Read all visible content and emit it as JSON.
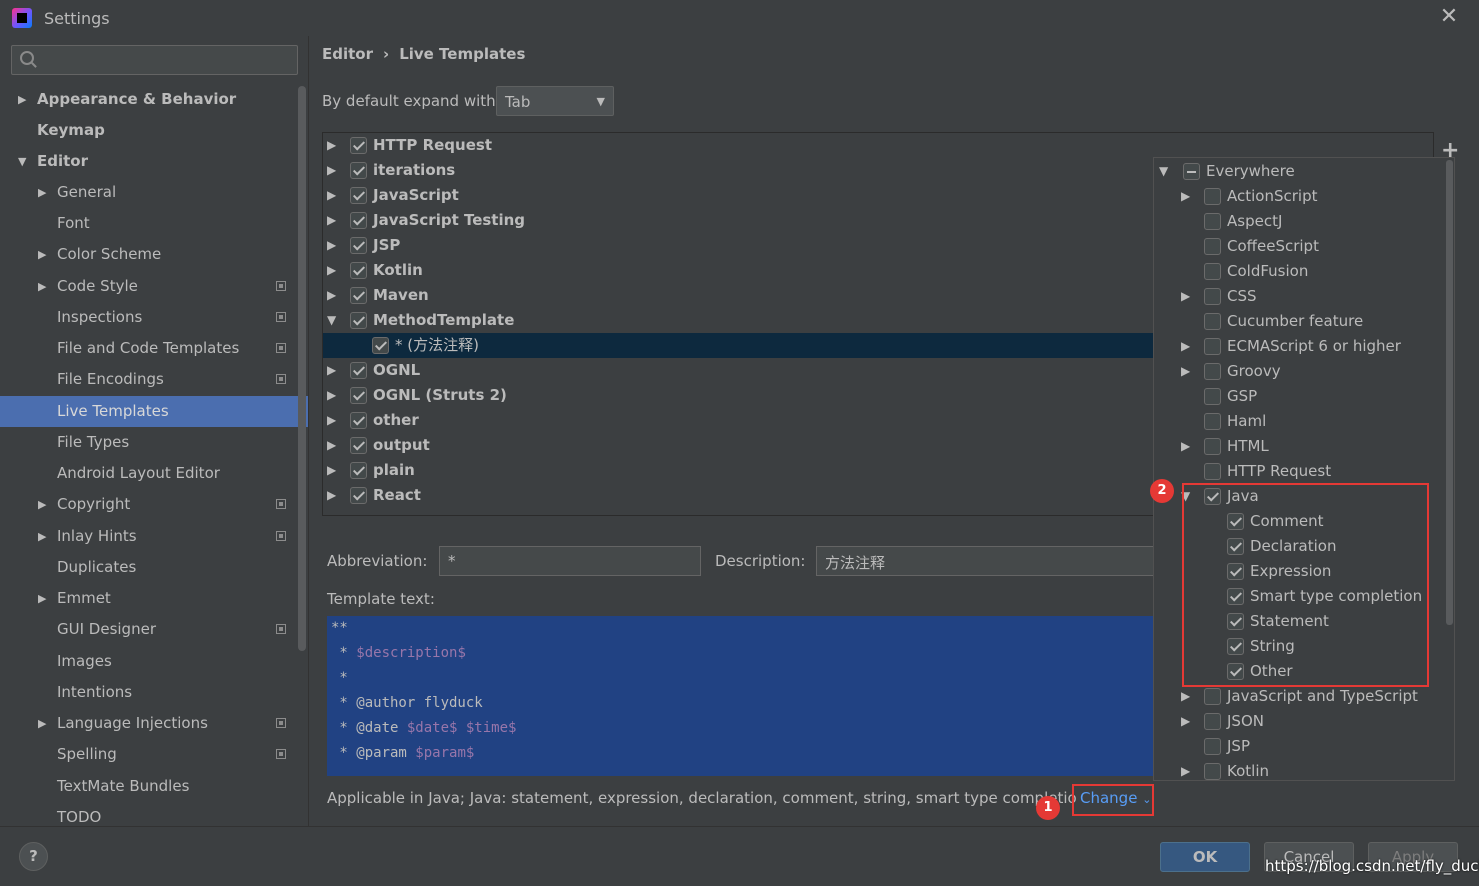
{
  "window": {
    "title": "Settings"
  },
  "sidebar": {
    "search_placeholder": "",
    "items": [
      {
        "label": "Appearance & Behavior"
      },
      {
        "label": "Keymap"
      },
      {
        "label": "Editor"
      },
      {
        "label": "General"
      },
      {
        "label": "Font"
      },
      {
        "label": "Color Scheme"
      },
      {
        "label": "Code Style"
      },
      {
        "label": "Inspections"
      },
      {
        "label": "File and Code Templates"
      },
      {
        "label": "File Encodings"
      },
      {
        "label": "Live Templates"
      },
      {
        "label": "File Types"
      },
      {
        "label": "Android Layout Editor"
      },
      {
        "label": "Copyright"
      },
      {
        "label": "Inlay Hints"
      },
      {
        "label": "Duplicates"
      },
      {
        "label": "Emmet"
      },
      {
        "label": "GUI Designer"
      },
      {
        "label": "Images"
      },
      {
        "label": "Intentions"
      },
      {
        "label": "Language Injections"
      },
      {
        "label": "Spelling"
      },
      {
        "label": "TextMate Bundles"
      },
      {
        "label": "TODO"
      }
    ]
  },
  "breadcrumb": {
    "parent": "Editor",
    "separator": "›",
    "current": "Live Templates"
  },
  "expand": {
    "label": "By default expand with",
    "value": "Tab"
  },
  "template_groups": [
    {
      "label": "HTTP Request",
      "checked": true
    },
    {
      "label": "iterations",
      "checked": true
    },
    {
      "label": "JavaScript",
      "checked": true
    },
    {
      "label": "JavaScript Testing",
      "checked": true
    },
    {
      "label": "JSP",
      "checked": true
    },
    {
      "label": "Kotlin",
      "checked": true
    },
    {
      "label": "Maven",
      "checked": true
    },
    {
      "label": "MethodTemplate",
      "checked": true,
      "expanded": true
    },
    {
      "label": "* (方法注释)",
      "checked": true,
      "child": true,
      "selected": true
    },
    {
      "label": "OGNL",
      "checked": true
    },
    {
      "label": "OGNL (Struts 2)",
      "checked": true
    },
    {
      "label": "other",
      "checked": true
    },
    {
      "label": "output",
      "checked": true
    },
    {
      "label": "plain",
      "checked": true
    },
    {
      "label": "React",
      "checked": true
    }
  ],
  "abbreviation": {
    "label": "Abbreviation:",
    "value": "*"
  },
  "description": {
    "label": "Description:",
    "value": "方法注释"
  },
  "template_text": {
    "label": "Template text:",
    "lines": [
      {
        "pre": "**",
        "var": ""
      },
      {
        "pre": " * ",
        "var": "$description$"
      },
      {
        "pre": " *",
        "var": ""
      },
      {
        "pre": " * @author flyduck",
        "var": ""
      },
      {
        "pre": " * @date ",
        "var": "$date$ $time$"
      },
      {
        "pre": " * @param ",
        "var": "$param$"
      }
    ]
  },
  "applicable": {
    "text": "Applicable in Java; Java: statement, expression, declaration, comment, string, smart type completio",
    "change_label": "Change",
    "badge1": "1"
  },
  "context_popup": {
    "badge2": "2",
    "items": [
      {
        "label": "Everywhere",
        "state": "mixed",
        "level": 0,
        "arrow": "▼"
      },
      {
        "label": "ActionScript",
        "state": "off",
        "level": 1,
        "arrow": "▶"
      },
      {
        "label": "AspectJ",
        "state": "off",
        "level": 1,
        "arrow": ""
      },
      {
        "label": "CoffeeScript",
        "state": "off",
        "level": 1,
        "arrow": ""
      },
      {
        "label": "ColdFusion",
        "state": "off",
        "level": 1,
        "arrow": ""
      },
      {
        "label": "CSS",
        "state": "off",
        "level": 1,
        "arrow": "▶"
      },
      {
        "label": "Cucumber feature",
        "state": "off",
        "level": 1,
        "arrow": ""
      },
      {
        "label": "ECMAScript 6 or higher",
        "state": "off",
        "level": 1,
        "arrow": "▶"
      },
      {
        "label": "Groovy",
        "state": "off",
        "level": 1,
        "arrow": "▶"
      },
      {
        "label": "GSP",
        "state": "off",
        "level": 1,
        "arrow": ""
      },
      {
        "label": "Haml",
        "state": "off",
        "level": 1,
        "arrow": ""
      },
      {
        "label": "HTML",
        "state": "off",
        "level": 1,
        "arrow": "▶"
      },
      {
        "label": "HTTP Request",
        "state": "off",
        "level": 1,
        "arrow": ""
      },
      {
        "label": "Java",
        "state": "on",
        "level": 1,
        "arrow": "▼"
      },
      {
        "label": "Comment",
        "state": "on",
        "level": 2,
        "arrow": ""
      },
      {
        "label": "Declaration",
        "state": "on",
        "level": 2,
        "arrow": ""
      },
      {
        "label": "Expression",
        "state": "on",
        "level": 2,
        "arrow": ""
      },
      {
        "label": "Smart type completion",
        "state": "on",
        "level": 2,
        "arrow": ""
      },
      {
        "label": "Statement",
        "state": "on",
        "level": 2,
        "arrow": ""
      },
      {
        "label": "String",
        "state": "on",
        "level": 2,
        "arrow": ""
      },
      {
        "label": "Other",
        "state": "on",
        "level": 2,
        "arrow": ""
      },
      {
        "label": "JavaScript and TypeScript",
        "state": "off",
        "level": 1,
        "arrow": "▶"
      },
      {
        "label": "JSON",
        "state": "off",
        "level": 1,
        "arrow": "▶"
      },
      {
        "label": "JSP",
        "state": "off",
        "level": 1,
        "arrow": ""
      },
      {
        "label": "Kotlin",
        "state": "off",
        "level": 1,
        "arrow": "▶"
      }
    ]
  },
  "buttons": {
    "ok": "OK",
    "cancel": "Cancel",
    "apply": "Apply",
    "help": "?"
  },
  "watermark": "https://blog.csdn.net/fly_duck",
  "colors": {
    "selection": "#4b6eaf",
    "editor_bg": "#214283",
    "highlight": "#e53935",
    "link": "#589df6"
  }
}
